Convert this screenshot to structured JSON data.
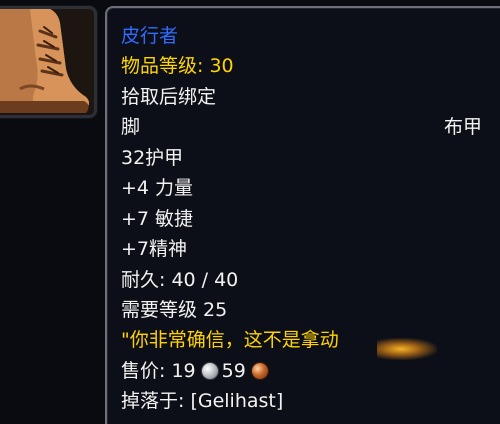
{
  "tooltip": {
    "item_name": "皮行者",
    "item_level": "物品等级: 30",
    "binding": "拾取后绑定",
    "slot": "脚",
    "armor_type": "布甲",
    "armor": "32护甲",
    "stat_1": "+4 力量",
    "stat_2": "+7 敏捷",
    "stat_3": "+7精神",
    "durability": "耐久: 40 / 40",
    "required_level": "需要等级 25",
    "flavor_text": "\"你非常确信，这不是拿动",
    "sell_price_label": "售价: 19",
    "sell_price_copper": "59",
    "drop_source": "掉落于: [Gelihast]"
  },
  "icons": {
    "item_icon": "leather-boot-icon",
    "silver_coin": "silver-coin-icon",
    "copper_coin": "copper-coin-icon"
  },
  "colors": {
    "item_name": "#2f6bff",
    "item_level": "#ffd500",
    "flavor_text": "#ffd200",
    "default_text": "#f2f2f2"
  }
}
